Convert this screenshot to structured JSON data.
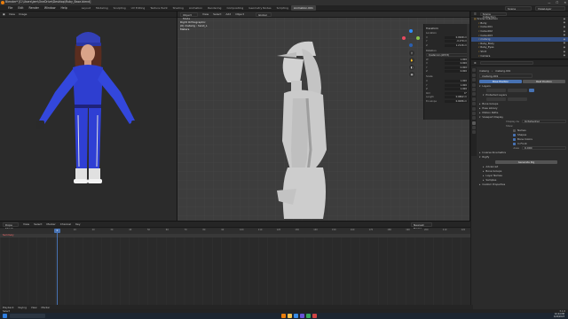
{
  "titlebar": {
    "title": "Blender* [C:\\Users\\jem\\OneDrive\\Desktop\\Ruby_Base.blend]",
    "minimize": "—",
    "maximize": "☐",
    "close": "✕"
  },
  "menu": [
    "File",
    "Edit",
    "Render",
    "Window",
    "Help"
  ],
  "workspaces": [
    "Layout",
    "Modeling",
    "Sculpting",
    "UV Editing",
    "Texture Paint",
    "Shading",
    "Animation",
    "Rendering",
    "Compositing",
    "Geometry Nodes",
    "Scripting",
    "Animation.001"
  ],
  "active_workspace": "Animation.001",
  "scene_field": "Scene",
  "viewlayer_field": "ViewLayer",
  "image_editor": {
    "header": [
      "View",
      "Image"
    ]
  },
  "viewport": {
    "header": [
      "Object Mode",
      "View",
      "Select",
      "Add",
      "Object"
    ],
    "header_right": "Global",
    "overlay_lines": [
      "Right Orthographic",
      "(0) metarig : hand_L",
      "Meters"
    ],
    "sidebar": {
      "title": "Transform",
      "section": "Location",
      "rows": [
        {
          "label": "X",
          "value": "0.0998 m"
        },
        {
          "label": "Y",
          "value": "-0.279 m"
        },
        {
          "label": "Z",
          "value": "1.2126 m"
        }
      ],
      "rotation_title": "Rotation",
      "rotation_mode": "Quaternion (WXYZ)",
      "rot_rows": [
        {
          "label": "W",
          "value": "1.000"
        },
        {
          "label": "X",
          "value": "0.000"
        },
        {
          "label": "Y",
          "value": "0.000"
        },
        {
          "label": "Z",
          "value": "0.000"
        }
      ],
      "scale_title": "Scale",
      "scale_rows": [
        {
          "label": "X",
          "value": "1.000"
        },
        {
          "label": "Y",
          "value": "1.000"
        },
        {
          "label": "Z",
          "value": "1.000"
        }
      ],
      "extra_rows": [
        {
          "label": "Roll",
          "value": "0°"
        },
        {
          "label": "Length",
          "value": "0.0862 m"
        },
        {
          "label": "Envelope",
          "value": "0.0086 m"
        }
      ],
      "tabs": [
        "Item",
        "Tool",
        "View"
      ]
    }
  },
  "outliner": {
    "header": "Scene Collection",
    "items": [
      {
        "label": "Scene Collection",
        "selected": false
      },
      {
        "label": "Body",
        "selected": false
      },
      {
        "label": "Cube.001",
        "selected": false
      },
      {
        "label": "Cube.002",
        "selected": false
      },
      {
        "label": "Cube.003",
        "selected": false
      },
      {
        "label": "metarig",
        "selected": true
      },
      {
        "label": "Ruby_Body",
        "selected": false
      },
      {
        "label": "Ruby_Eyes",
        "selected": false
      },
      {
        "label": "Shirt",
        "selected": false
      },
      {
        "label": "Camera",
        "selected": false
      }
    ]
  },
  "properties": {
    "breadcrumb": [
      "metarig",
      "metarig.001"
    ],
    "name_field": "metarig.001",
    "pose_position": "Pose Position",
    "rest_position": "Rest Position",
    "layers_title": "Layers",
    "protected_layers": "Protected Layers",
    "bone_groups": "Bone Groups",
    "pose_library": "Pose Library",
    "motion_paths": "Motion Paths",
    "viewport_display": "Viewport Display",
    "display_as_label": "Display As",
    "display_as_value": "Octahedral",
    "show_label": "Show",
    "show_items": [
      {
        "label": "Names",
        "on": false
      },
      {
        "label": "Shapes",
        "on": true
      },
      {
        "label": "Bone Colors",
        "on": true
      },
      {
        "label": "In Front",
        "on": true
      }
    ],
    "axes_label": "Axes",
    "axes_value": "0.000",
    "inverse_kinematics": "Inverse Kinematics",
    "rigify": "Rigify",
    "generate_rig": "Generate Rig",
    "advanced": "Advanced",
    "bone_groups2": "Bone Groups",
    "layer_names": "Layer Names",
    "samples": "Samples",
    "custom_properties": "Custom Properties"
  },
  "timeline": {
    "header": [
      "Dope Sheet",
      "View",
      "Select",
      "Marker",
      "Channel",
      "Key"
    ],
    "header_right": "Nearest Frame",
    "summary": "Summary",
    "current_frame": "0",
    "ticks": [
      0,
      5,
      10,
      15,
      20,
      25,
      30,
      35,
      40,
      45,
      50,
      55,
      60,
      65,
      70,
      75,
      80,
      85,
      90,
      95,
      100,
      105,
      110,
      115,
      120,
      125,
      130,
      135,
      140,
      145,
      150,
      155,
      160,
      165,
      170,
      175,
      180,
      185,
      190,
      195,
      200,
      205,
      210,
      215,
      220,
      225,
      230,
      235,
      240,
      245,
      250
    ],
    "footer": [
      "Playback",
      "Keying",
      "View",
      "Marker"
    ]
  },
  "status": {
    "left": "Select",
    "right": "3.1.0"
  },
  "taskbar": {
    "clock": "10:44 PM",
    "date": "1/26/2023"
  },
  "colors": {
    "accent": "#4772b3",
    "selection": "#334d80",
    "brand": "#e87d0d"
  }
}
